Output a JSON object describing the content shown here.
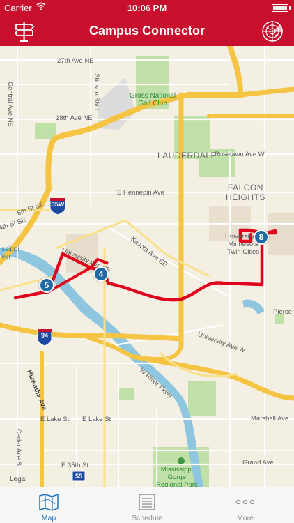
{
  "status_bar": {
    "carrier": "Carrier",
    "time": "10:06 PM"
  },
  "nav": {
    "title": "Campus Connector",
    "left_icon": "signpost-icon",
    "right_icon": "radar-icon"
  },
  "colors": {
    "brand": "#c8102e",
    "route": "#e0001b",
    "stop": "#1d6aa5",
    "active_tab": "#1e73be"
  },
  "map": {
    "labels": {
      "street_27th": "27th Ave NE",
      "street_18th": "18th Ave NE",
      "central": "Central Ave NE",
      "stinson": "Stinson Blvd",
      "golf": "Gross National\nGolf Club",
      "lauderdale": "LAUDERDALE",
      "roselawn": "Roselawn Ave W",
      "falcon": "FALCON\nHEIGHTS",
      "hennepin": "E Hennepin Ave",
      "eighth": "8th St SE",
      "fourth": "4th St SE",
      "kasota": "Kasota Ave SE",
      "university_se": "University Ave SE",
      "campus": "University of\nMinnesota\nTwin Cities",
      "mississippi_river": "ssippi\nver",
      "university_w": "University Ave W",
      "pierce": "Pierce",
      "w_river": "W River Pkwy",
      "hiawatha": "Hiawatha Ave",
      "marshall": "Marshall Ave",
      "e_lake": "E Lake St",
      "e_lake2": "E Lake St",
      "cedar": "Cedar Ave S",
      "grand": "Grand Ave",
      "e35th": "E 35th St",
      "gorge_park": "Mississippi\nGorge\nRegional Park",
      "legal": "Legal"
    },
    "shields": {
      "i35w": "35W",
      "i94": "94",
      "r55": "55"
    },
    "stops": [
      {
        "id": "stop-5",
        "label": "5"
      },
      {
        "id": "stop-4",
        "label": "4"
      },
      {
        "id": "stop-8",
        "label": "8"
      }
    ]
  },
  "tabs": [
    {
      "label": "Map",
      "icon": "map-icon",
      "active": true
    },
    {
      "label": "Schedule",
      "icon": "schedule-icon",
      "active": false
    },
    {
      "label": "More",
      "icon": "more-icon",
      "active": false
    }
  ]
}
